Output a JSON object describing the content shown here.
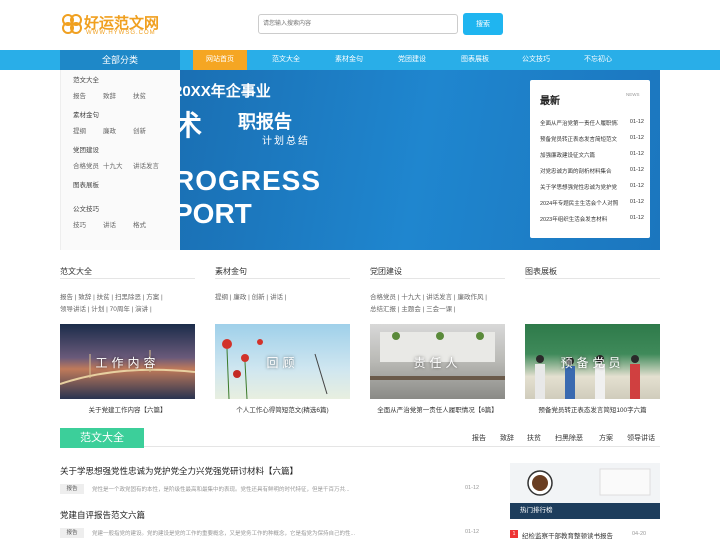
{
  "header": {
    "site_name": "好运范文网",
    "site_url": "WWW.HYWSG.COM",
    "search_placeholder": "请您输入搜索内容",
    "search_button": "搜索"
  },
  "nav": {
    "all": "全部分类",
    "items": [
      "网站首页",
      "范文大全",
      "素材金句",
      "党团建设",
      "图表展板",
      "公文技巧",
      "不忘初心"
    ],
    "active_index": 0
  },
  "categories": [
    {
      "title": "范文大全",
      "links": [
        "报告",
        "致辞",
        "扶贫"
      ]
    },
    {
      "title": "素材金句",
      "links": [
        "提纲",
        "廉政",
        "创新"
      ]
    },
    {
      "title": "党团建设",
      "links": [
        "合格党员",
        "十九大",
        "讲话发言"
      ]
    },
    {
      "title": "图表展板",
      "links": []
    },
    {
      "title": "公文技巧",
      "links": [
        "技巧",
        "讲话",
        "格式"
      ]
    }
  ],
  "banner": {
    "year_line": "20XX年企事业",
    "big_char": "术",
    "title": "职报告",
    "subtitle": "计划总结",
    "en1": "ROGRESS",
    "en2": "PORT"
  },
  "latest": {
    "title": "最新",
    "news_label": "NEWS",
    "items": [
      {
        "title": "全面从严治党第一责任人履职情况",
        "date": "01-12"
      },
      {
        "title": "预备党员转正表态发言简短范文",
        "date": "01-12"
      },
      {
        "title": "加强廉政建设征文六篇",
        "date": "01-12"
      },
      {
        "title": "对党忠诚方面的剖析材料集合",
        "date": "01-12"
      },
      {
        "title": "关于学思想强党性忠诚为党护党",
        "date": "01-12"
      },
      {
        "title": "2024年专题民主生活会个人对照",
        "date": "01-12"
      },
      {
        "title": "2023年组织生活会发言材料",
        "date": "01-12"
      }
    ]
  },
  "columns": [
    {
      "title": "范文大全",
      "lines": [
        [
          "报告",
          "致辞",
          "扶贫",
          "扫黑除恶",
          "方案"
        ],
        [
          "领导讲话",
          "计划",
          "70周年",
          "演讲"
        ]
      ]
    },
    {
      "title": "素材金句",
      "lines": [
        [
          "提纲",
          "廉政",
          "创新",
          "讲话"
        ]
      ]
    },
    {
      "title": "党团建设",
      "lines": [
        [
          "合格党员",
          "十九大",
          "讲话发言",
          "廉政作风"
        ],
        [
          "总结汇报",
          "主题会",
          "三会一课"
        ]
      ]
    },
    {
      "title": "图表展板",
      "lines": []
    }
  ],
  "cards": [
    {
      "overlay": "工作内容",
      "caption": "关于党建工作内容【六篇】"
    },
    {
      "overlay": "回顾",
      "caption": "个人工作心得简短范文(精选6篇)"
    },
    {
      "overlay": "责任人",
      "caption": "全面从严治党第一责任人履职情况【6篇】"
    },
    {
      "overlay": "预备党员",
      "caption": "预备党员转正表态发言简短100字六篇"
    }
  ],
  "section": {
    "tab": "范文大全",
    "links": [
      "报告",
      "致辞",
      "扶贫",
      "扫黑除恶",
      "方案",
      "领导讲话"
    ]
  },
  "articles": [
    {
      "title": "关于学思想强党性忠诚为党护党全力兴党强党研讨材料【六篇】",
      "tag": "报告",
      "desc": "党性是一个政党固有的本性，是阶级性最高和最集中的表现。党性还具有鲜明的时代特征，但是千百万共...",
      "date": "01-12"
    },
    {
      "title": "党建自评报告范文六篇",
      "tag": "报告",
      "desc": "党建一般指党的建设。党的建设是党的工作的重要概念，又是党务工作的种概念，它是指党为保持自己的性...",
      "date": "01-12"
    }
  ],
  "hot": {
    "label": "热门排行榜",
    "items": [
      {
        "num": "1",
        "title": "纪检监察干部教育整顿读书报告",
        "date": "04-20"
      }
    ]
  }
}
